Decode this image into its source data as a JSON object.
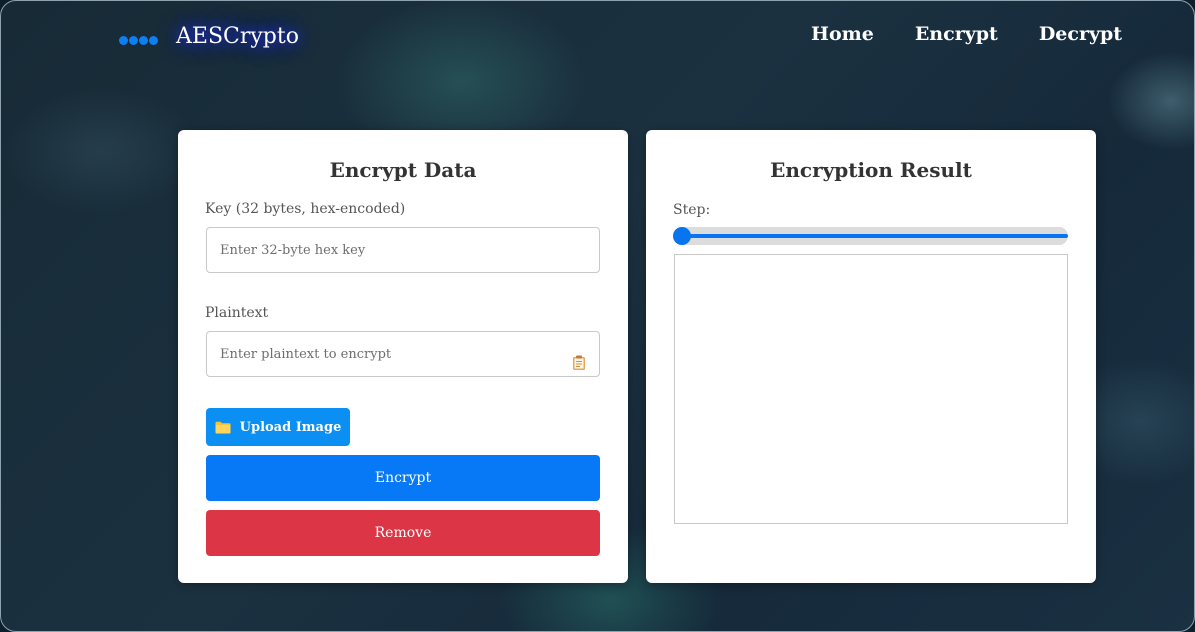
{
  "navbar": {
    "brand": "AESCrypto",
    "links": [
      {
        "label": "Home"
      },
      {
        "label": "Encrypt"
      },
      {
        "label": "Decrypt"
      }
    ]
  },
  "encrypt_card": {
    "title": "Encrypt Data",
    "key_label": "Key (32 bytes, hex-encoded)",
    "key_placeholder": "Enter 32-byte hex key",
    "key_value": "",
    "plaintext_label": "Plaintext",
    "plaintext_placeholder": "Enter plaintext to encrypt",
    "plaintext_value": "",
    "upload_label": "Upload Image",
    "encrypt_label": "Encrypt",
    "remove_label": "Remove"
  },
  "result_card": {
    "title": "Encryption Result",
    "step_label": "Step:",
    "step_value": 0,
    "result_text": ""
  },
  "icons": {
    "logo": "dots-logo-icon",
    "paste": "clipboard-icon",
    "upload": "folder-icon"
  },
  "colors": {
    "primary": "#0779f7",
    "upload": "#0c8ff2",
    "danger": "#dc3545",
    "brand_glow": "#1d2cff"
  }
}
